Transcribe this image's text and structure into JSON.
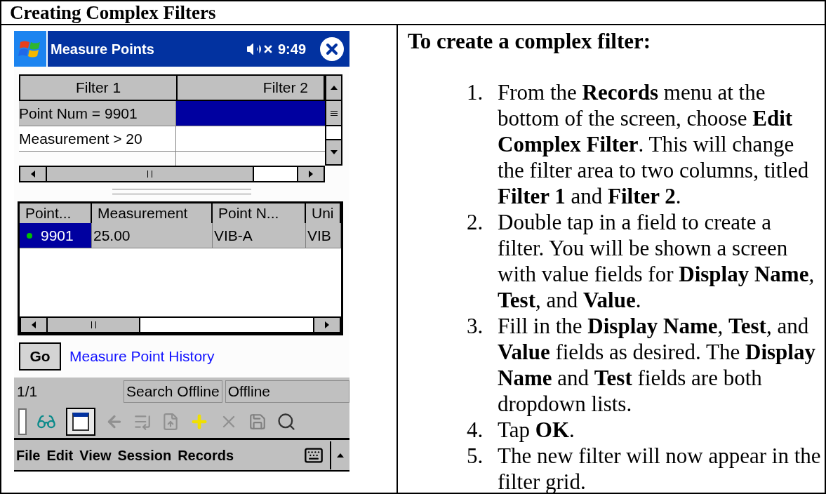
{
  "heading": "Creating Complex Filters",
  "device": {
    "title_bar": {
      "title": "Measure Points",
      "time": "9:49"
    },
    "filter_grid": {
      "columns": [
        "Filter 1",
        "Filter 2"
      ],
      "rows": [
        {
          "filter_1": "Point Num = 9901",
          "selected": true
        },
        {
          "filter_1": "Measurement > 20",
          "selected": false
        }
      ]
    },
    "data_grid": {
      "columns": [
        "Point...",
        "Measurement",
        "Point N...",
        "Uni"
      ],
      "rows": [
        {
          "cells": [
            "9901",
            "25.00",
            "VIB-A",
            "VIB"
          ],
          "selected": true,
          "color": "#00c000"
        }
      ]
    },
    "go_button": "Go",
    "link": "Measure Point History",
    "status_bar": {
      "count": "1/1",
      "fields": [
        "Search Offline",
        "Offline"
      ]
    },
    "menu": [
      "File",
      "Edit",
      "View",
      "Session",
      "Records"
    ]
  },
  "instructions": {
    "title": "To create a complex filter:",
    "steps": [
      {
        "number": "1.",
        "text": "From the **Records** menu at the bottom of the screen, choose **Edit Complex Filter**. This will change the filter area to two columns, titled **Filter 1** and **Filter 2**."
      },
      {
        "number": "2.",
        "text": "Double tap in a field to create a filter. You will be shown a screen with value fields for **Display Name**, **Test**, and **Value**."
      },
      {
        "number": "3.",
        "text": "Fill in the **Display Name**, **Test**, and **Value** fields as desired. The **Display Name** and **Test** fields are both dropdown lists."
      },
      {
        "number": "4.",
        "text": "Tap **OK**."
      },
      {
        "number": "5.",
        "text": "The new filter will now appear in the filter grid."
      }
    ]
  }
}
